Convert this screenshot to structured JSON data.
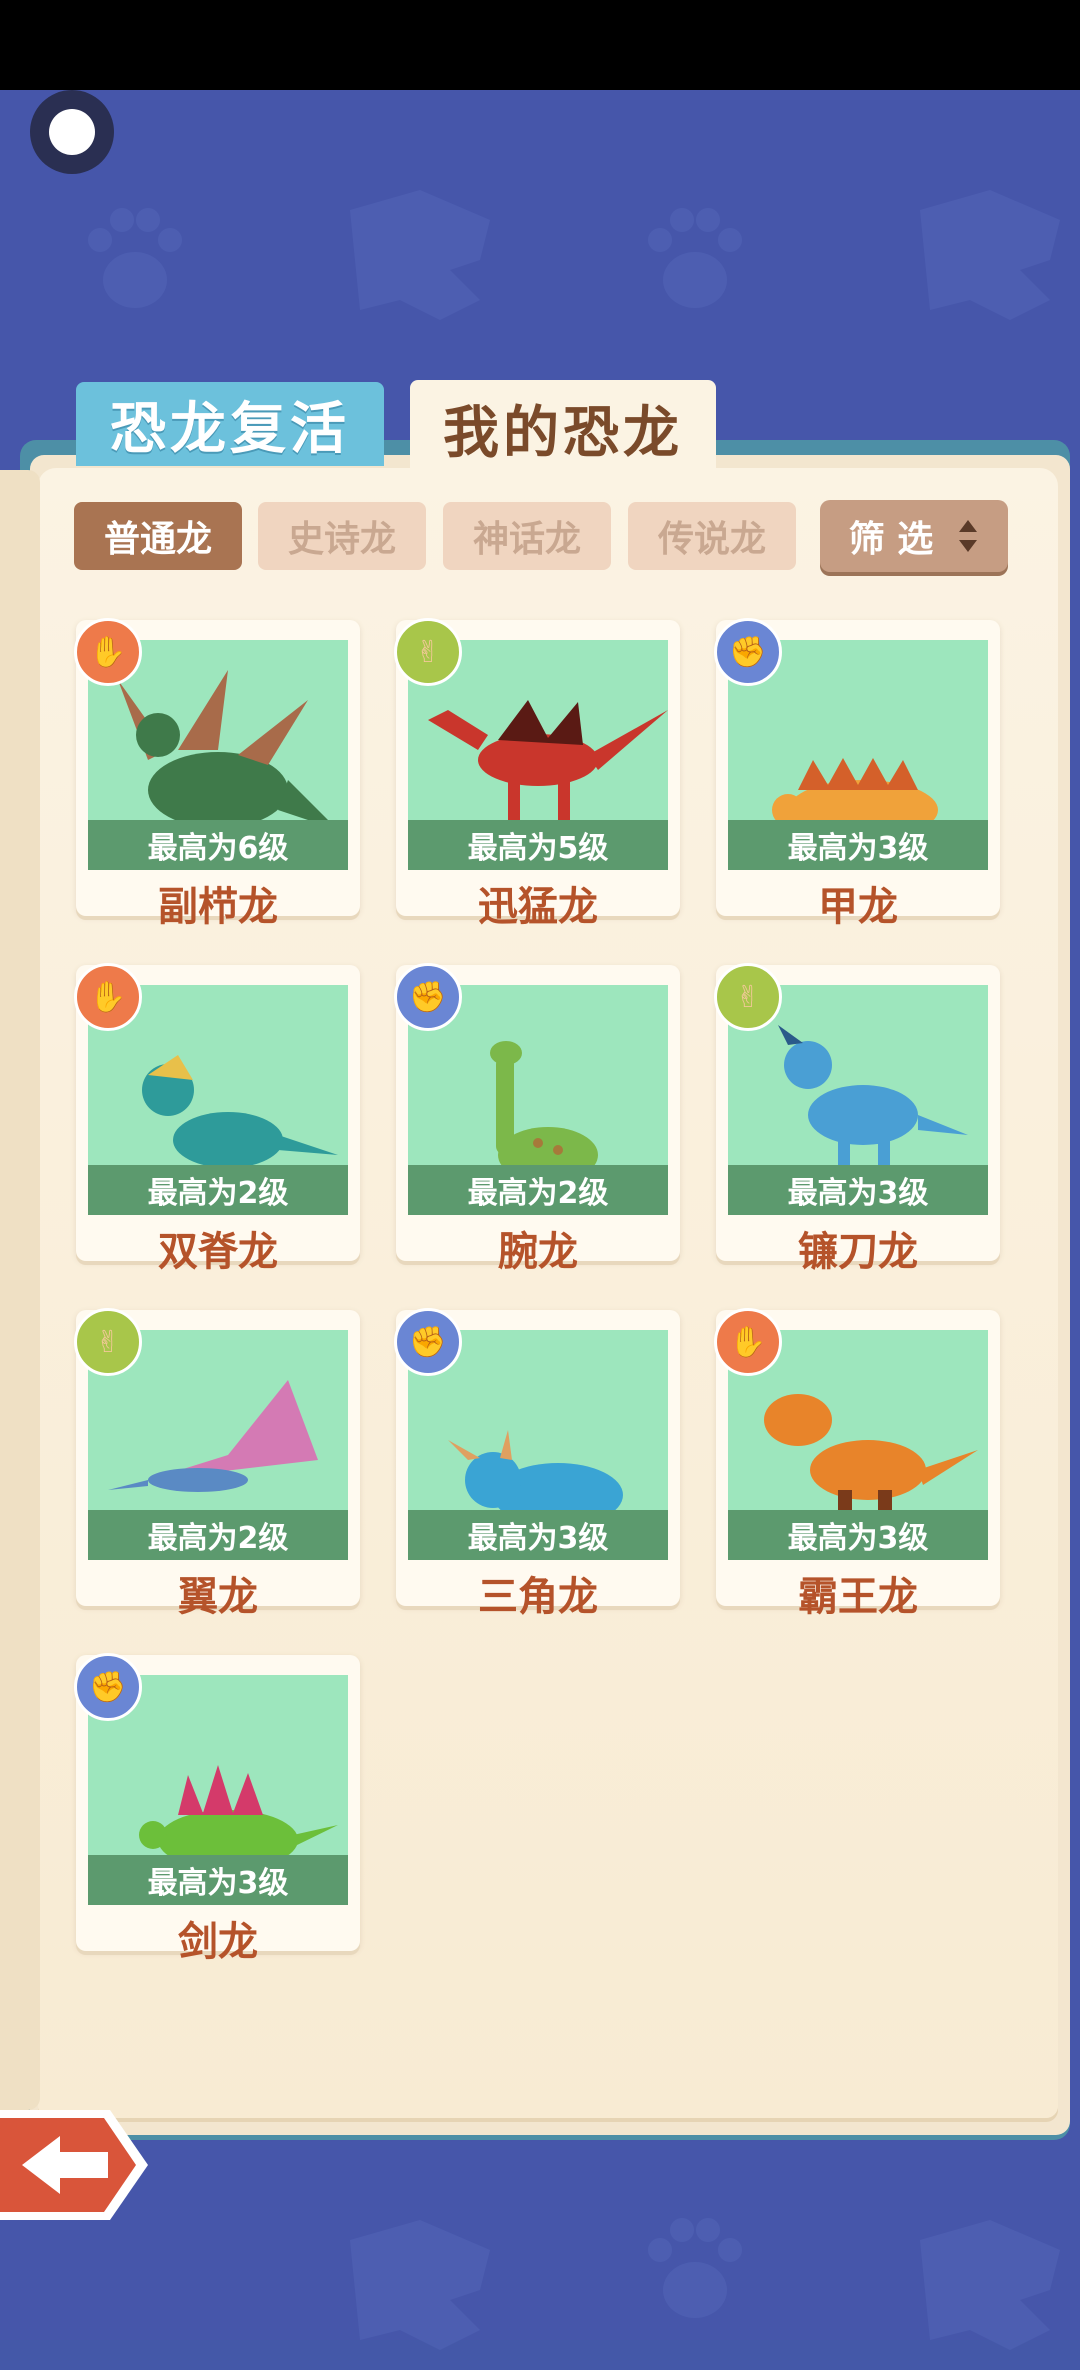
{
  "main_tabs": [
    {
      "label": "恐龙复活"
    },
    {
      "label": "我的恐龙"
    }
  ],
  "sub_tabs": [
    {
      "label": "普通龙"
    },
    {
      "label": "史诗龙"
    },
    {
      "label": "神话龙"
    },
    {
      "label": "传说龙"
    }
  ],
  "filter": {
    "label": "筛 选"
  },
  "cards": [
    {
      "name": "副栉龙",
      "level": "最高为6级",
      "badge": "orange",
      "badge_icon": "palm-icon",
      "body_color": "#3f7a4a",
      "accent": "#a86b4a"
    },
    {
      "name": "迅猛龙",
      "level": "最高为5级",
      "badge": "green",
      "badge_icon": "scissors-icon",
      "body_color": "#c9362c",
      "accent": "#5a1a14"
    },
    {
      "name": "甲龙",
      "level": "最高为3级",
      "badge": "blue",
      "badge_icon": "fist-icon",
      "body_color": "#f0a23a",
      "accent": "#d4602a"
    },
    {
      "name": "双脊龙",
      "level": "最高为2级",
      "badge": "orange",
      "badge_icon": "palm-icon",
      "body_color": "#2e9b9a",
      "accent": "#e8c04a"
    },
    {
      "name": "腕龙",
      "level": "最高为2级",
      "badge": "blue",
      "badge_icon": "fist-icon",
      "body_color": "#7cb84a",
      "accent": "#a67a3a"
    },
    {
      "name": "镰刀龙",
      "level": "最高为3级",
      "badge": "green",
      "badge_icon": "scissors-icon",
      "body_color": "#4a9fd4",
      "accent": "#2a5a8a"
    },
    {
      "name": "翼龙",
      "level": "最高为2级",
      "badge": "green",
      "badge_icon": "scissors-icon",
      "body_color": "#5a8ac4",
      "accent": "#d47ab4"
    },
    {
      "name": "三角龙",
      "level": "最高为3级",
      "badge": "blue",
      "badge_icon": "fist-icon",
      "body_color": "#3aa4d4",
      "accent": "#e0a060"
    },
    {
      "name": "霸王龙",
      "level": "最高为3级",
      "badge": "orange",
      "badge_icon": "palm-icon",
      "body_color": "#e8842a",
      "accent": "#7a3a1a"
    },
    {
      "name": "剑龙",
      "level": "最高为3级",
      "badge": "blue",
      "badge_icon": "fist-icon",
      "body_color": "#6cbf3a",
      "accent": "#d43a6a"
    }
  ],
  "colors": {
    "background": "#4656aa",
    "active_tab": "#a97452",
    "card_art": "#9de6bd",
    "name_text": "#b5532a"
  }
}
